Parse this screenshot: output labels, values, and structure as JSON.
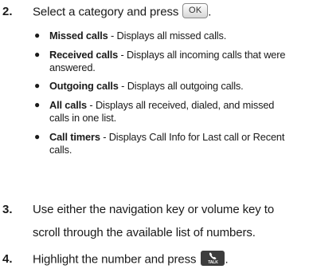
{
  "steps": [
    {
      "number": "2.",
      "text": "Select a category and press",
      "key_label": "OK",
      "suffix": ".",
      "bullets": [
        {
          "term": "Missed calls",
          "desc": " - Displays all missed calls."
        },
        {
          "term": "Received calls",
          "desc": " - Displays all incoming calls that were answered."
        },
        {
          "term": "Outgoing calls",
          "desc": " - Displays all outgoing calls."
        },
        {
          "term": "All calls",
          "desc": " - Displays all received, dialed, and missed calls in one list."
        },
        {
          "term": "Call timers",
          "desc": " - Displays Call Info for Last call or Recent calls."
        }
      ]
    },
    {
      "number": "3.",
      "text": "Use either the navigation key or volume key to scroll through the available list of numbers."
    },
    {
      "number": "4.",
      "text": "Highlight the number and press",
      "key_label": "TALK",
      "key_icon": "phone-handset-icon",
      "suffix": "."
    }
  ],
  "colors": {
    "text": "#1a1a1a",
    "talk_key": "#3d3d3d",
    "ok_key_border": "#8a8a8a"
  }
}
